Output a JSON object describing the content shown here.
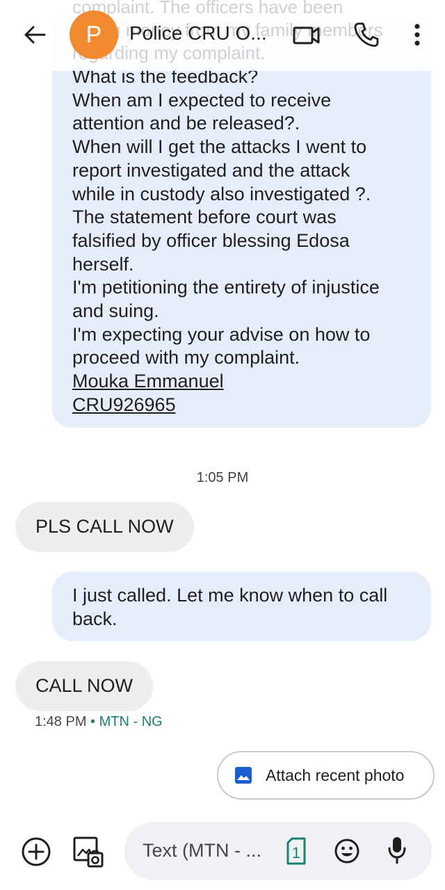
{
  "header": {
    "ghost_lines": [
      "complaint. The officers have been",
      "taking money from my family members",
      "regarding my complaint."
    ],
    "avatar_letter": "P",
    "avatar_color": "#f28b2f",
    "contact_name": "Police CRU O...",
    "icons": {
      "back": "arrow-left-icon",
      "video": "video-camera-icon",
      "call": "phone-icon",
      "more": "more-vert-icon"
    }
  },
  "conversation": {
    "long_message_lines": [
      "What is the feedback?",
      "When am I expected to receive",
      "attention and be released?.",
      "When will I get the attacks I went to",
      "report investigated and the attack",
      "while in custody also investigated ?.",
      "The statement before court was",
      "falsified by officer blessing Edosa",
      "herself.",
      "I'm petitioning the entirety of injustice",
      "and suing.",
      "I'm expecting your advise on how to",
      "proceed with my complaint."
    ],
    "signature_name": "Mouka Emmanuel",
    "signature_ref": "CRU926965",
    "timestamp": "1:05 PM",
    "msg_pls": "PLS CALL NOW",
    "msg_just_line1": "I just called. Let me know when to call",
    "msg_just_line2": "back.",
    "msg_call": "CALL NOW",
    "meta_time": "1:48 PM",
    "meta_sep": "•",
    "meta_carrier": "MTN - NG"
  },
  "suggestion": {
    "label": "Attach recent photo",
    "icon": "image-icon"
  },
  "compose": {
    "placeholder": "Text (MTN - ...",
    "sim_number": "1",
    "icons": {
      "add": "add-circle-icon",
      "gallery": "gallery-icon",
      "sim": "sim-card-icon",
      "emoji": "emoji-icon",
      "mic": "microphone-icon"
    }
  },
  "colors": {
    "outgoing_bubble": "#e6edfa",
    "incoming_bubble": "#eeeeee",
    "accent_teal": "#1a7f72",
    "photo_blue": "#1a5fd0"
  }
}
